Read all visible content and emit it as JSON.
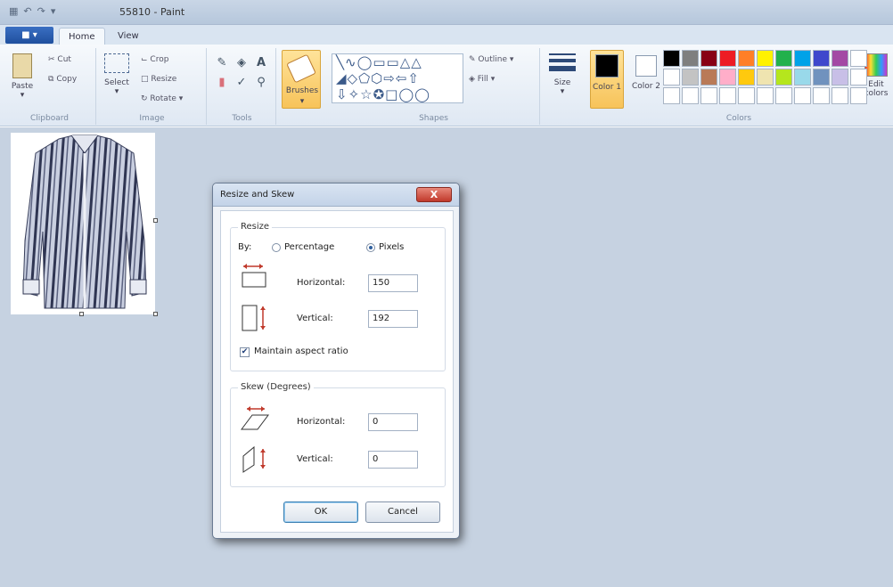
{
  "window": {
    "title": "55810 - Paint"
  },
  "tabs": [
    {
      "label": "Home"
    },
    {
      "label": "View"
    }
  ],
  "clipboard": {
    "paste": "Paste",
    "cut": "Cut",
    "copy": "Copy",
    "group": "Clipboard"
  },
  "image_group": {
    "select": "Select",
    "crop": "Crop",
    "resize": "Resize",
    "rotate": "Rotate",
    "group": "Image"
  },
  "tools_group": {
    "group": "Tools"
  },
  "brushes": {
    "label": "Brushes"
  },
  "shapes_group": {
    "outline": "Outline",
    "fill": "Fill",
    "group": "Shapes"
  },
  "size": {
    "label": "Size"
  },
  "colors_group": {
    "color1": "Color 1",
    "color2": "Color 2",
    "edit_colors": "Edit colors",
    "group": "Colors",
    "color1_value": "#000000",
    "color2_value": "#ffffff",
    "palette_row1": [
      "#000000",
      "#7f7f7f",
      "#880015",
      "#ed1c24",
      "#ff7f27",
      "#fff200",
      "#22b14c",
      "#00a2e8",
      "#3f48cc",
      "#a349a4"
    ],
    "palette_row2": [
      "#ffffff",
      "#c3c3c3",
      "#b97a57",
      "#ffaec9",
      "#ffc90e",
      "#efe4b0",
      "#b5e61d",
      "#99d9ea",
      "#7092be",
      "#c8bfe7"
    ]
  },
  "dialog": {
    "title": "Resize and Skew",
    "close": "X",
    "resize_legend": "Resize",
    "by_label": "By:",
    "percentage": "Percentage",
    "pixels": "Pixels",
    "selected_unit": "Pixels",
    "horizontal_label": "Horizontal:",
    "horizontal_value": "150",
    "vertical_label": "Vertical:",
    "vertical_value": "192",
    "maintain_aspect": "Maintain aspect ratio",
    "maintain_aspect_checked": true,
    "skew_legend": "Skew (Degrees)",
    "skew_horizontal_label": "Horizontal:",
    "skew_horizontal_value": "0",
    "skew_vertical_label": "Vertical:",
    "skew_vertical_value": "0",
    "ok": "OK",
    "cancel": "Cancel"
  }
}
